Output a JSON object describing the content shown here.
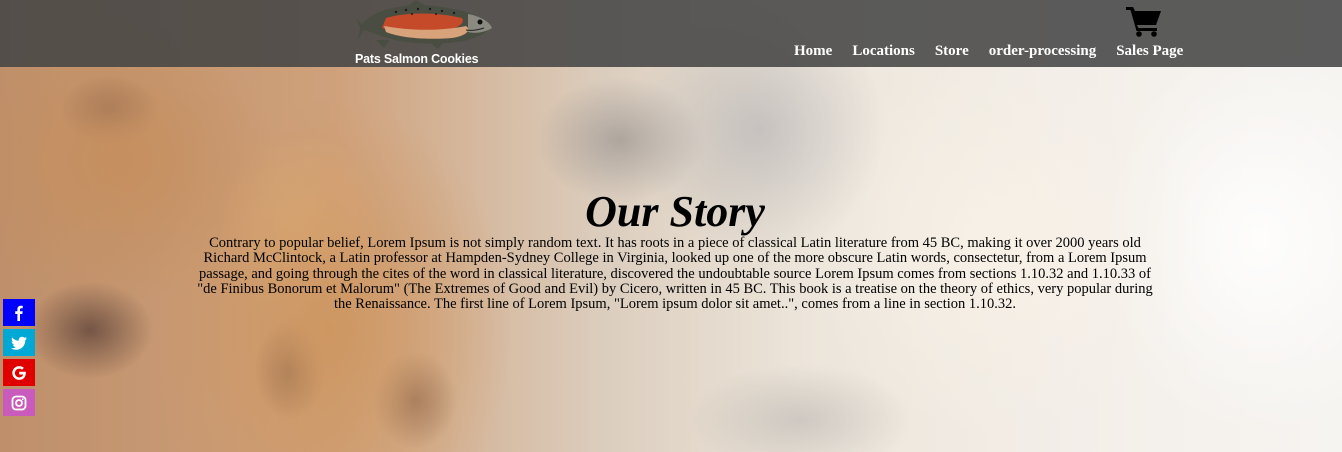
{
  "header": {
    "brand_name": "Pats Salmon Cookies",
    "logo_icon": "salmon-logo",
    "cart_icon": "shopping-cart-icon",
    "nav": [
      {
        "label": "Home"
      },
      {
        "label": "Locations"
      },
      {
        "label": "Store"
      },
      {
        "label": "order-processing"
      },
      {
        "label": "Sales Page"
      }
    ]
  },
  "main": {
    "title": "Our Story",
    "body": "Contrary to popular belief, Lorem Ipsum is not simply random text. It has roots in a piece of classical Latin literature from 45 BC, making it over 2000 years old Richard McClintock, a Latin professor at Hampden-Sydney College in Virginia, looked up one of the more obscure Latin words, consectetur, from a Lorem Ipsum passage, and going through the cites of the word in classical literature, discovered the undoubtable source Lorem Ipsum comes from sections 1.10.32 and 1.10.33 of \"de Finibus Bonorum et Malorum\" (The Extremes of Good and Evil) by Cicero, written in 45 BC. This book is a treatise on the theory of ethics, very popular during the Renaissance. The first line of Lorem Ipsum, \"Lorem ipsum dolor sit amet..\", comes from a line in section 1.10.32."
  },
  "social": [
    {
      "name": "facebook",
      "icon": "facebook-icon",
      "color": "#0000ff"
    },
    {
      "name": "twitter",
      "icon": "twitter-icon",
      "color": "#00a8d6"
    },
    {
      "name": "google",
      "icon": "google-icon",
      "color": "#e00000"
    },
    {
      "name": "instagram",
      "icon": "instagram-icon",
      "color": "#c95bbd"
    }
  ]
}
